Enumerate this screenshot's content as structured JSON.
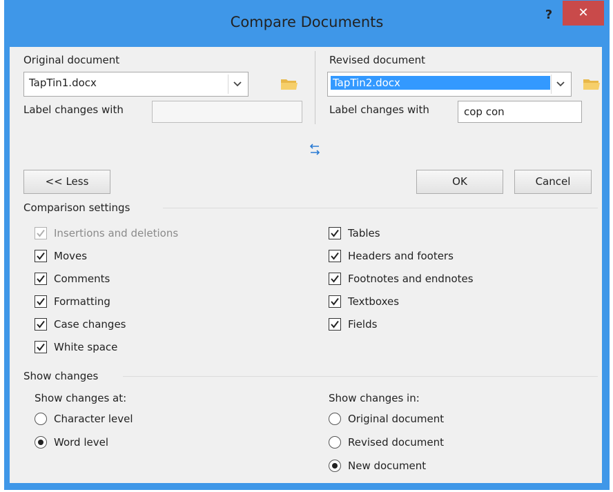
{
  "dialog": {
    "title": "Compare Documents",
    "help_glyph": "?",
    "close_glyph": "✕"
  },
  "original": {
    "heading": "Original document",
    "file": "TapTin1.docx",
    "label_text": "Label changes with",
    "label_value": ""
  },
  "revised": {
    "heading": "Revised document",
    "file": "TapTin2.docx",
    "label_text": "Label changes with",
    "label_value": "cop con"
  },
  "buttons": {
    "less": "<< Less",
    "ok": "OK",
    "cancel": "Cancel"
  },
  "comparison": {
    "heading": "Comparison settings",
    "left": [
      {
        "label": "Insertions and deletions",
        "checked": true,
        "enabled": false
      },
      {
        "label": "Moves",
        "checked": true,
        "enabled": true
      },
      {
        "label": "Comments",
        "checked": true,
        "enabled": true
      },
      {
        "label": "Formatting",
        "checked": true,
        "enabled": true
      },
      {
        "label": "Case changes",
        "checked": true,
        "enabled": true
      },
      {
        "label": "White space",
        "checked": true,
        "enabled": true
      }
    ],
    "right": [
      {
        "label": "Tables",
        "checked": true,
        "enabled": true
      },
      {
        "label": "Headers and footers",
        "checked": true,
        "enabled": true
      },
      {
        "label": "Footnotes and endnotes",
        "checked": true,
        "enabled": true
      },
      {
        "label": "Textboxes",
        "checked": true,
        "enabled": true
      },
      {
        "label": "Fields",
        "checked": true,
        "enabled": true
      }
    ]
  },
  "show_changes": {
    "heading": "Show changes",
    "at_heading": "Show changes at:",
    "at_options": [
      {
        "label": "Character level",
        "selected": false
      },
      {
        "label": "Word level",
        "selected": true
      }
    ],
    "in_heading": "Show changes in:",
    "in_options": [
      {
        "label": "Original document",
        "selected": false
      },
      {
        "label": "Revised document",
        "selected": false
      },
      {
        "label": "New document",
        "selected": true
      }
    ]
  },
  "icons": {
    "swap": "swap-arrows-icon",
    "folder": "folder-icon",
    "dropdown": "chevron-down-icon",
    "check": "checkmark-icon"
  },
  "colors": {
    "window_frame": "#3f97e8",
    "close_button": "#c94a4a",
    "selection": "#3399ff",
    "dialog_bg": "#f0f0f0"
  }
}
